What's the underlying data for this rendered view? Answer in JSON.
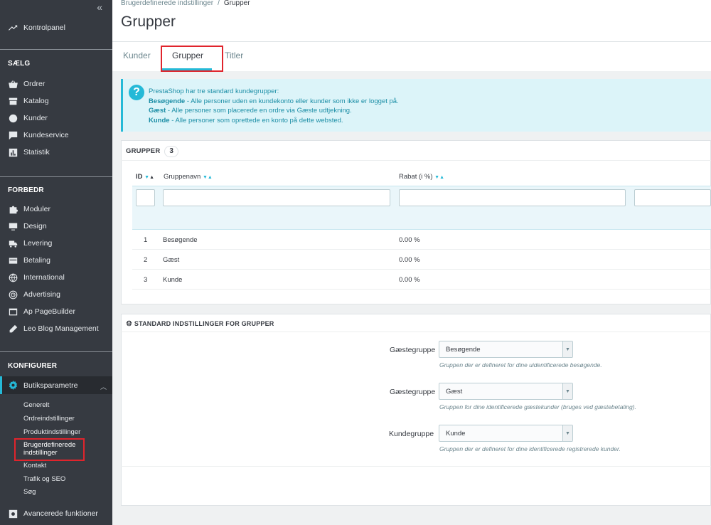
{
  "sidebar": {
    "collapse": "«",
    "dashboard": "Kontrolpanel",
    "sections": {
      "sell": "SÆLG",
      "improve": "FORBEDR",
      "configure": "KONFIGURER"
    },
    "sell_items": [
      "Ordrer",
      "Katalog",
      "Kunder",
      "Kundeservice",
      "Statistik"
    ],
    "improve_items": [
      "Moduler",
      "Design",
      "Levering",
      "Betaling",
      "International",
      "Advertising",
      "Ap PageBuilder",
      "Leo Blog Management"
    ],
    "configure_item": "Butiksparametre",
    "sub_items": [
      "Generelt",
      "Ordreindstillinger",
      "Produktindstillinger",
      "Brugerdefinerede indstillinger",
      "Kontakt",
      "Trafik og SEO",
      "Søg"
    ],
    "sub_active_line1": "Brugerdefinerede",
    "sub_active_line2": "indstillinger",
    "advanced": "Avancerede funktioner"
  },
  "header": {
    "breadcrumb_parent": "Brugerdefinerede indstillinger",
    "breadcrumb_sep": "/",
    "breadcrumb_current": "Grupper",
    "title": "Grupper",
    "tabs": [
      "Kunder",
      "Grupper",
      "Titler"
    ]
  },
  "alert": {
    "intro": "PrestaShop har tre standard kundegrupper:",
    "lines": [
      {
        "bold": "Besøgende",
        "text": " - Alle personer uden en kundekonto eller kunder som ikke er logget på."
      },
      {
        "bold": "Gæst",
        "text": " - Alle personer som placerede en ordre via Gæste udtjekning."
      },
      {
        "bold": "Kunde",
        "text": " - Alle personer som oprettede en konto på dette websted."
      }
    ]
  },
  "groups_panel": {
    "title": "GRUPPER",
    "count": "3",
    "columns": [
      "ID",
      "Gruppenavn",
      "Rabat (i %)"
    ],
    "rows": [
      {
        "id": "1",
        "name": "Besøgende",
        "discount": "0.00 %"
      },
      {
        "id": "2",
        "name": "Gæst",
        "discount": "0.00 %"
      },
      {
        "id": "3",
        "name": "Kunde",
        "discount": "0.00 %"
      }
    ]
  },
  "settings_panel": {
    "title": "STANDARD INDSTILLINGER FOR GRUPPER",
    "fields": [
      {
        "label": "Gæstegruppe",
        "value": "Besøgende",
        "help": "Gruppen der er defineret for dine uidentificerede besøgende."
      },
      {
        "label": "Gæstegruppe",
        "value": "Gæst",
        "help": "Gruppen for dine identificerede gæstekunder (bruges ved gæstebetaling)."
      },
      {
        "label": "Kundegruppe",
        "value": "Kunde",
        "help": "Gruppen der er defineret for dine identificerede registrerede kunder."
      }
    ]
  },
  "colors": {
    "sidebar_bg": "#363a41",
    "accent": "#25b9d7",
    "highlight": "#e0242c"
  }
}
